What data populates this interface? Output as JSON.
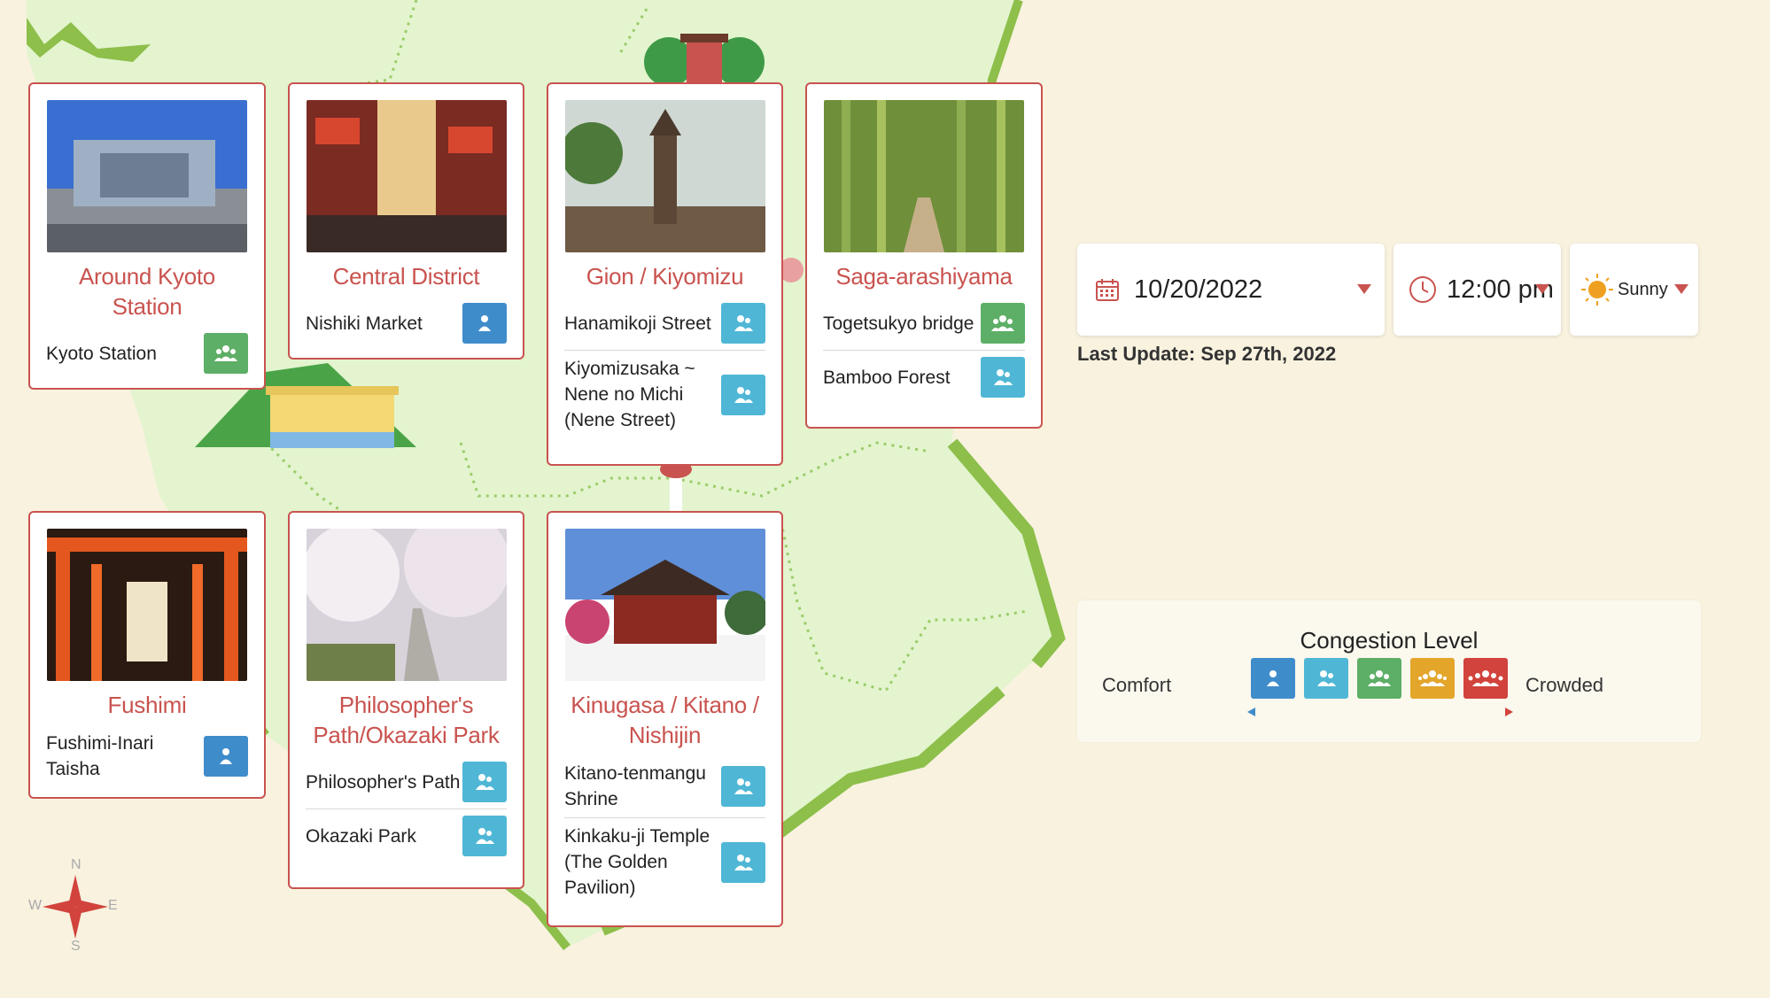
{
  "areas": [
    {
      "title": "Around Kyoto Station",
      "spots": [
        {
          "name": "Kyoto Station",
          "level": 3
        }
      ]
    },
    {
      "title": "Central District",
      "spots": [
        {
          "name": "Nishiki Market",
          "level": 1
        }
      ]
    },
    {
      "title": "Gion / Kiyomizu",
      "spots": [
        {
          "name": "Hanamikoji Street",
          "level": 2
        },
        {
          "name": "Kiyomizusaka ~ Nene no Michi (Nene Street)",
          "level": 2
        }
      ]
    },
    {
      "title": "Saga-arashiyama",
      "spots": [
        {
          "name": "Togetsukyo bridge",
          "level": 3
        },
        {
          "name": "Bamboo Forest",
          "level": 2
        }
      ]
    },
    {
      "title": "Fushimi",
      "spots": [
        {
          "name": "Fushimi-Inari Taisha",
          "level": 1
        }
      ]
    },
    {
      "title": "Philosopher's Path/Okazaki Park",
      "spots": [
        {
          "name": "Philosopher's Path",
          "level": 2
        },
        {
          "name": "Okazaki Park",
          "level": 2
        }
      ]
    },
    {
      "title": "Kinugasa / Kitano / Nishijin",
      "spots": [
        {
          "name": "Kitano-tenmangu Shrine",
          "level": 2
        },
        {
          "name": "Kinkaku-ji Temple (The Golden Pavilion)",
          "level": 2
        }
      ]
    }
  ],
  "controls": {
    "date": "10/20/2022",
    "time": "12:00 pm",
    "weather": "Sunny"
  },
  "last_update": "Last Update: Sep 27th, 2022",
  "legend": {
    "title": "Congestion Level",
    "low_label": "Comfort",
    "high_label": "Crowded"
  },
  "compass": {
    "n": "N",
    "s": "S",
    "e": "E",
    "w": "W"
  },
  "colors": {
    "accent": "#c9534f",
    "level1": "#3f8ccb",
    "level2": "#4fb7d5",
    "level3": "#5dae66",
    "level4": "#e3a52a",
    "level5": "#d1433c",
    "map_land": "#e3f4cf",
    "map_border": "#8dbf4a"
  }
}
